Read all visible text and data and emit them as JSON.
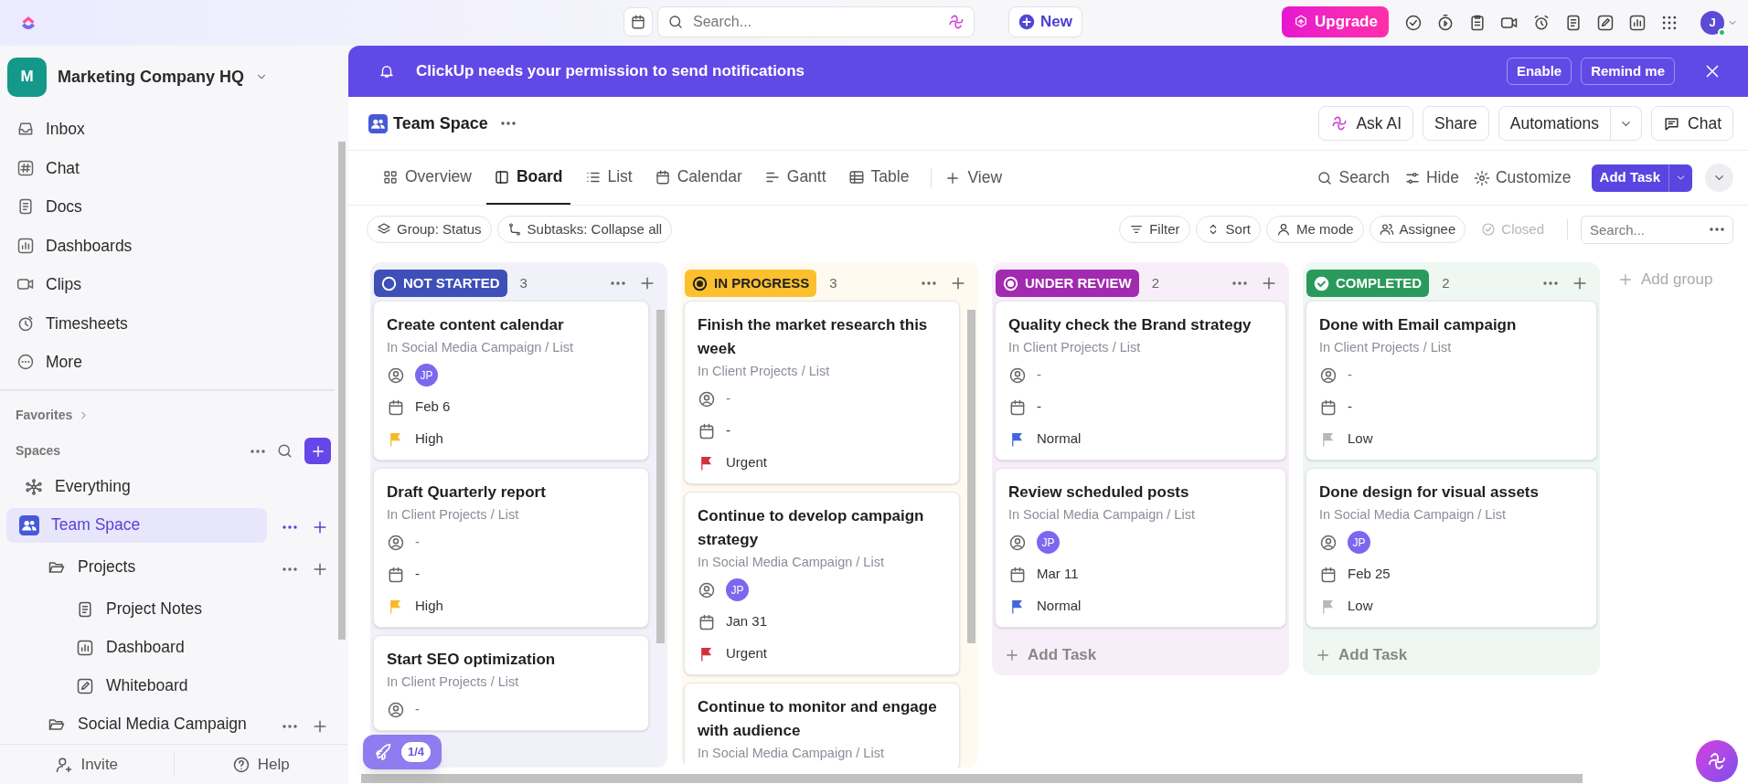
{
  "topbar": {
    "search_placeholder": "Search...",
    "new_button": "New",
    "upgrade_button": "Upgrade",
    "avatar": "J"
  },
  "sidebar": {
    "workspace": {
      "initial": "M",
      "name": "Marketing Company HQ"
    },
    "nav": [
      "Inbox",
      "Chat",
      "Docs",
      "Dashboards",
      "Clips",
      "Timesheets",
      "More"
    ],
    "favorites": "Favorites",
    "spaces_label": "Spaces",
    "tree": [
      {
        "label": "Everything",
        "kind": "everything",
        "selected": false
      },
      {
        "label": "Team Space",
        "kind": "space",
        "selected": true,
        "children": [
          {
            "label": "Projects",
            "kind": "folder",
            "selected": false,
            "children": [
              {
                "label": "Project Notes",
                "kind": "doc",
                "selected": false
              },
              {
                "label": "Dashboard",
                "kind": "dashboard",
                "selected": false
              },
              {
                "label": "Whiteboard",
                "kind": "whiteboard",
                "selected": false
              }
            ]
          },
          {
            "label": "Social Media Campaign",
            "kind": "folder",
            "selected": false
          }
        ]
      }
    ],
    "footer": [
      "Invite",
      "Help"
    ]
  },
  "banner": {
    "message": "ClickUp needs your permission to send notifications",
    "buttons": [
      "Enable",
      "Remind me"
    ]
  },
  "header": {
    "title": "Team Space",
    "buttons": [
      "Ask AI",
      "Share",
      "Automations",
      "Chat"
    ]
  },
  "views": [
    {
      "label": "Overview",
      "selected": false
    },
    {
      "label": "Board",
      "selected": true
    },
    {
      "label": "List",
      "selected": false
    },
    {
      "label": "Calendar",
      "selected": false
    },
    {
      "label": "Gantt",
      "selected": false
    },
    {
      "label": "Table",
      "selected": false
    }
  ],
  "add_view": "View",
  "view_actions": [
    "Search",
    "Hide",
    "Customize"
  ],
  "add_task_button": "Add Task",
  "toolbar": {
    "left": [
      "Group: Status",
      "Subtasks: Collapse all"
    ],
    "right": [
      {
        "label": "Filter",
        "disabled": false
      },
      {
        "label": "Sort",
        "disabled": false
      },
      {
        "label": "Me mode",
        "disabled": false
      },
      {
        "label": "Assignee",
        "disabled": false
      },
      {
        "label": "Closed",
        "disabled": true
      }
    ],
    "search_placeholder": "Search..."
  },
  "columns": [
    {
      "status": "NOT STARTED",
      "count": "3",
      "color": "#3f4fb8",
      "tasks": [
        {
          "title": "Create content calendar",
          "location": "In Social Media Campaign / List",
          "assignee": {
            "kind": "avatar",
            "text": "JP"
          },
          "date": "Feb 6",
          "priority": {
            "label": "High",
            "color": "#f7b928"
          }
        },
        {
          "title": "Draft Quarterly report",
          "location": "In Client Projects / List",
          "assignee": {
            "kind": "empty",
            "text": "-"
          },
          "date": "-",
          "priority": {
            "label": "High",
            "color": "#f7b928"
          }
        },
        {
          "title": "Start SEO optimization",
          "location": "In Client Projects / List",
          "assignee": {
            "kind": "empty",
            "text": "-"
          }
        }
      ]
    },
    {
      "status": "IN PROGRESS",
      "count": "3",
      "color": "#fcc02e",
      "tasks": [
        {
          "title": "Finish the market research this week",
          "location": "In Client Projects / List",
          "assignee": {
            "kind": "empty",
            "text": "-"
          },
          "date": "-",
          "priority": {
            "label": "Urgent",
            "color": "#d0313a"
          }
        },
        {
          "title": "Continue to develop campaign strategy",
          "location": "In Social Media Campaign / List",
          "assignee": {
            "kind": "avatar",
            "text": "JP"
          },
          "date": "Jan 31",
          "priority": {
            "label": "Urgent",
            "color": "#d0313a"
          }
        },
        {
          "title": "Continue to monitor and engage with audience",
          "location": "In Social Media Campaign / List"
        }
      ]
    },
    {
      "status": "UNDER REVIEW",
      "count": "2",
      "color": "#a22ab0",
      "add_task": "Add Task",
      "tasks": [
        {
          "title": "Quality check the Brand strategy",
          "location": "In Client Projects / List",
          "assignee": {
            "kind": "empty",
            "text": "-"
          },
          "date": "-",
          "priority": {
            "label": "Normal",
            "color": "#4466dd"
          }
        },
        {
          "title": "Review scheduled posts",
          "location": "In Social Media Campaign / List",
          "assignee": {
            "kind": "avatar",
            "text": "JP"
          },
          "date": "Mar 11",
          "priority": {
            "label": "Normal",
            "color": "#4466dd"
          }
        }
      ]
    },
    {
      "status": "COMPLETED",
      "count": "2",
      "color": "#2a9a5c",
      "add_task": "Add Task",
      "tasks": [
        {
          "title": "Done with Email campaign",
          "location": "In Client Projects / List",
          "assignee": {
            "kind": "empty",
            "text": "-"
          },
          "date": "-",
          "priority": {
            "label": "Low",
            "color": "#b5b8bd"
          }
        },
        {
          "title": "Done design for visual assets",
          "location": "In Social Media Campaign / List",
          "assignee": {
            "kind": "avatar",
            "text": "JP"
          },
          "date": "Feb 25",
          "priority": {
            "label": "Low",
            "color": "#b5b8bd"
          }
        }
      ]
    }
  ],
  "add_group": "Add group",
  "onboarding": {
    "progress": "1/4"
  }
}
